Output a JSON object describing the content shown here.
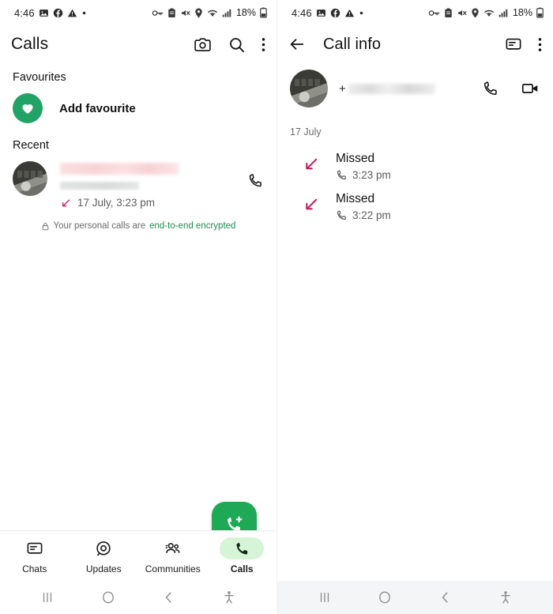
{
  "status_bar": {
    "time": "4:46",
    "battery": "18%",
    "left_icons": [
      "photos-icon",
      "facebook-icon",
      "warning-icon",
      "dot-icon"
    ],
    "right_icons": [
      "vpn-key-icon",
      "clipboard-icon",
      "mute-icon",
      "location-icon",
      "wifi-icon",
      "signal-icon"
    ]
  },
  "left_panel": {
    "app_bar": {
      "title": "Calls",
      "actions": [
        "camera-icon",
        "search-icon",
        "overflow-menu-icon"
      ]
    },
    "favourites": {
      "section_label": "Favourites",
      "add_label": "Add favourite",
      "icon": "heart-icon",
      "accent": "#21a366"
    },
    "recent": {
      "section_label": "Recent",
      "entry": {
        "name": "",
        "subtitle": "",
        "direction_icon": "missed-call-arrow-icon",
        "meta": "17 July, 3:23 pm",
        "call_action_icon": "phone-icon"
      }
    },
    "encryption_notice": {
      "icon": "lock-icon",
      "text": "Your personal calls are ",
      "link": "end-to-end encrypted",
      "link_color": "#1f8a54"
    },
    "fab": {
      "icon": "new-call-icon",
      "color": "#1fa855"
    },
    "bottom_nav": {
      "items": [
        {
          "label": "Chats",
          "icon": "chats-icon",
          "active": false
        },
        {
          "label": "Updates",
          "icon": "updates-icon",
          "active": false
        },
        {
          "label": "Communities",
          "icon": "communities-icon",
          "active": false
        },
        {
          "label": "Calls",
          "icon": "calls-icon",
          "active": true
        }
      ],
      "active_pill_color": "#d6f5d6"
    }
  },
  "right_panel": {
    "app_bar": {
      "back_icon": "back-arrow-icon",
      "title": "Call info",
      "actions": [
        "message-icon",
        "overflow-menu-icon"
      ]
    },
    "contact": {
      "phone_prefix": "+",
      "phone_number": "",
      "actions": [
        "voice-call-icon",
        "video-call-icon"
      ]
    },
    "date_header": "17 July",
    "call_log": [
      {
        "status": "Missed",
        "time": "3:23 pm",
        "direction_icon": "missed-call-arrow-icon",
        "type_icon": "phone-icon"
      },
      {
        "status": "Missed",
        "time": "3:22 pm",
        "direction_icon": "missed-call-arrow-icon",
        "type_icon": "phone-icon"
      }
    ],
    "missed_color": "#c2185b"
  },
  "system_nav": {
    "buttons": [
      "recents-icon",
      "home-icon",
      "back-icon",
      "accessibility-icon"
    ]
  }
}
